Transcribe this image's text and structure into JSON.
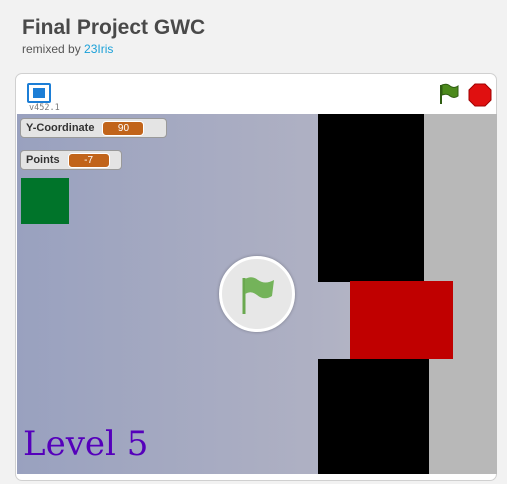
{
  "header": {
    "title": "Final Project GWC",
    "remixed_label": "remixed by ",
    "author": "23Iris"
  },
  "player": {
    "version": "v452.1",
    "icons": {
      "fullscreen": "fullscreen-icon",
      "green_flag": "green-flag-icon",
      "stop": "stop-sign-icon",
      "start_overlay": "green-flag-icon"
    },
    "colors": {
      "flag_green": "#4c8a1c",
      "stop_red": "#e01010",
      "accent_blue": "#1c7ed6"
    }
  },
  "stage": {
    "monitors": [
      {
        "label": "Y-Coordinate",
        "value": "90"
      },
      {
        "label": "Points",
        "value": "-7"
      }
    ],
    "level_text": "Level 5",
    "colors": {
      "green_sprite": "#00742a",
      "red_block": "#c00000",
      "walls": "#000000",
      "level_text": "#5500bb"
    }
  }
}
